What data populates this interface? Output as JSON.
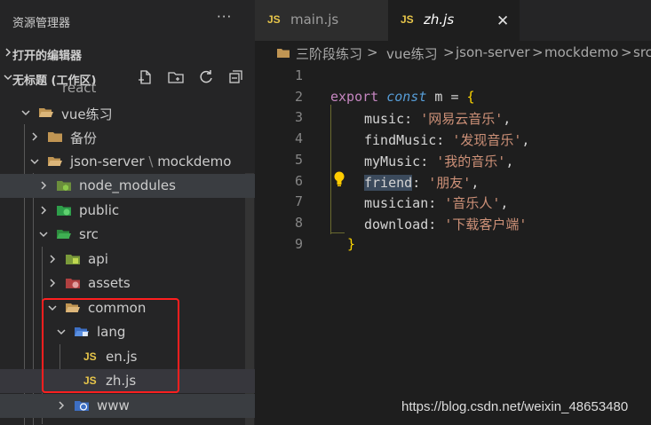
{
  "sidebar": {
    "title": "资源管理器",
    "more_glyph": "···",
    "open_editors_label": "打开的编辑器",
    "workspace_label": "无标题 (工作区)",
    "partial_top_item": "react",
    "tree": [
      {
        "label": "vue练习",
        "type": "folder",
        "expanded": true
      },
      {
        "label": "备份",
        "type": "folder",
        "expanded": false
      },
      {
        "label": "json-server",
        "sep": "\\",
        "label2": "mockdemo",
        "type": "folder",
        "expanded": true
      },
      {
        "label": "node_modules",
        "type": "folder-node",
        "expanded": false
      },
      {
        "label": "public",
        "type": "folder-public",
        "expanded": false
      },
      {
        "label": "src",
        "type": "folder-src",
        "expanded": true
      },
      {
        "label": "api",
        "type": "folder-api",
        "expanded": false
      },
      {
        "label": "assets",
        "type": "folder-assets",
        "expanded": false
      },
      {
        "label": "common",
        "type": "folder",
        "expanded": true
      },
      {
        "label": "lang",
        "type": "folder-lang",
        "expanded": true
      },
      {
        "label": "en.js",
        "type": "js"
      },
      {
        "label": "zh.js",
        "type": "js"
      },
      {
        "label": "www",
        "type": "folder-www",
        "expanded": false
      }
    ],
    "js_badge": "JS"
  },
  "tabs": [
    {
      "label": "main.js",
      "badge": "JS",
      "active": false
    },
    {
      "label": "zh.js",
      "badge": "JS",
      "active": true,
      "close_glyph": "✕"
    }
  ],
  "breadcrumb": [
    "三阶段练习",
    "vue练习",
    "json-server",
    "mockdemo",
    "src"
  ],
  "breadcrumb_sep": ">",
  "code": {
    "line_numbers": [
      "1",
      "2",
      "3",
      "4",
      "5",
      "6",
      "7",
      "8",
      "9"
    ],
    "line2": {
      "kw_export": "export",
      "kw_const": "const",
      "name": "m",
      "eq": "=",
      "brace": "{"
    },
    "props": [
      {
        "key": "music",
        "value": "'网易云音乐'",
        "comma": ","
      },
      {
        "key": "findMusic",
        "value": "'发现音乐'",
        "comma": ","
      },
      {
        "key": "myMusic",
        "value": "'我的音乐'",
        "comma": ","
      },
      {
        "key": "friend",
        "value": "'朋友'",
        "comma": ","
      },
      {
        "key": "musician",
        "value": "'音乐人'",
        "comma": ","
      },
      {
        "key": "download",
        "value": "'下载客户端'",
        "comma": ""
      }
    ],
    "colon": ":",
    "close_brace": "}"
  },
  "watermark": "https://blog.csdn.net/weixin_48653480",
  "colors": {
    "js_yellow": "#e8c64a",
    "annotation_red": "#ff1f1f",
    "keyword_pink": "#c586c0",
    "string_orange": "#ce9178"
  }
}
